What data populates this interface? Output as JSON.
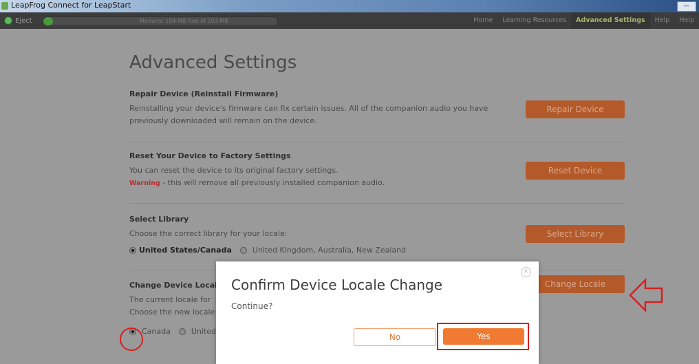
{
  "window": {
    "title": "LeapFrog Connect for LeapStart",
    "minimize_label": "—",
    "maximize_label": "□"
  },
  "toolbar": {
    "eject_label": "Eject",
    "memory_text": "Memory: 194 MB free of 203 MB",
    "nav": [
      {
        "label": "Home",
        "active": false
      },
      {
        "label": "Learning Resources",
        "active": false
      },
      {
        "label": "Advanced Settings",
        "active": true
      },
      {
        "label": "Help",
        "active": false
      },
      {
        "label": "Help",
        "active": false
      }
    ]
  },
  "page": {
    "title": "Advanced Settings",
    "repair": {
      "title": "Repair Device (Reinstall Firmware)",
      "desc": "Reinstalling your device's firmware can fix certain issues. All of the companion audio you have previously downloaded will remain on the device.",
      "button": "Repair Device"
    },
    "reset": {
      "title": "Reset Your Device to Factory Settings",
      "desc": "You can reset the device to its original factory settings.",
      "warning_label": "Warning",
      "warning_text": " - this will remove all previously installed companion audio.",
      "button": "Reset Device"
    },
    "library": {
      "title": "Select Library",
      "desc": "Choose the correct library for your locale:",
      "option_selected": "United States/Canada",
      "option_other": "United Kingdom, Australia, New Zealand",
      "button": "Select Library"
    },
    "locale": {
      "title": "Change Device Locale",
      "desc_line1": "The current locale for",
      "desc_line2": "Choose the new locale",
      "option_selected": "Canada",
      "option_other": "United",
      "button": "Change Locale"
    }
  },
  "dialog": {
    "title": "Confirm Device Locale Change",
    "message": "Continue?",
    "no_label": "No",
    "yes_label": "Yes"
  },
  "colors": {
    "accent_orange": "#f07a32",
    "annotation_red": "#d62020"
  }
}
